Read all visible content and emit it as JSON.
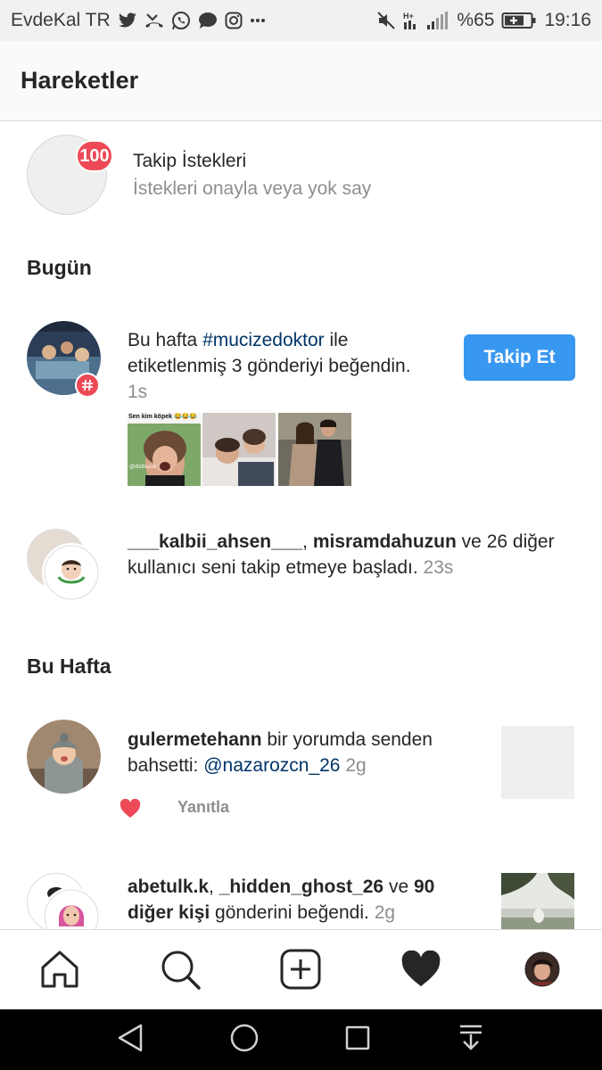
{
  "status_bar": {
    "carrier": "EvdeKal TR",
    "battery_percent": "%65",
    "time": "19:16",
    "icons_left": [
      "twitter-icon",
      "missed-call-icon",
      "whatsapp-icon",
      "message-icon",
      "instagram-icon",
      "more-dots-icon"
    ],
    "icons_right": [
      "mute-icon",
      "signal-4g-icon",
      "signal-bars-icon",
      "battery-charging-icon"
    ]
  },
  "header": {
    "title": "Hareketler"
  },
  "follow_requests": {
    "badge": "100",
    "title": "Takip İstekleri",
    "subtitle": "İstekleri onayla veya yok say"
  },
  "sections": {
    "today": "Bugün",
    "this_week": "Bu Hafta"
  },
  "notifications": {
    "hashtag": {
      "text_1": "Bu hafta ",
      "tag": "#mucizedoktor",
      "text_2": " ile etiketlenmiş 3 gönderiyi beğendin.",
      "time": "1s",
      "button": "Takip Et",
      "thumb_caption": "Sen kim köpek 😂😂😂",
      "thumb_watermark": "@dizihuzur"
    },
    "follow": {
      "user_1": "___kalbii_ahsen___",
      "sep": ", ",
      "user_2": "misramdahuzun",
      "text": " ve 26 diğer kullanıcı seni takip etmeye başladı. ",
      "time": "23s"
    },
    "mention": {
      "user": "gulermetehann",
      "text": " bir yorumda senden bahsetti: ",
      "mention": "@nazarozcn_26",
      "time": " 2g",
      "reply": "Yanıtla"
    },
    "likes": {
      "user_1": "abetulk.k",
      "sep": ", ",
      "user_2": "_hidden_ghost_26",
      "text_1": " ve ",
      "others": "90 diğer kişi",
      "text_2": " gönderini beğendi. ",
      "time": "2g"
    }
  },
  "colors": {
    "accent_blue": "#3897f0",
    "badge_red": "#ed4956",
    "link_navy": "#003569",
    "muted_gray": "#8e8e8e"
  },
  "bottom_nav": [
    "home-icon",
    "search-icon",
    "add-post-icon",
    "heart-icon",
    "profile-avatar"
  ],
  "system_nav": [
    "back-icon",
    "home-circle-icon",
    "recents-icon",
    "notification-pull-icon"
  ]
}
